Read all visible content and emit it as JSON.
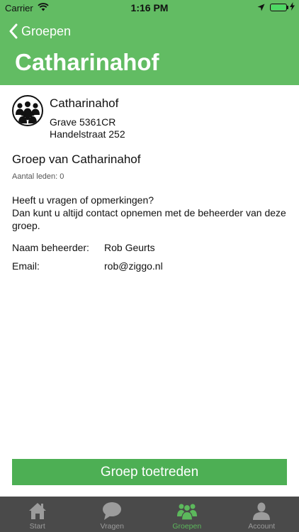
{
  "status_bar": {
    "carrier": "Carrier",
    "time": "1:16 PM"
  },
  "nav": {
    "back_label": "Groepen",
    "title": "Catharinahof"
  },
  "organization": {
    "name": "Catharinahof",
    "city_postcode": "Grave 5361CR",
    "street": "Handelstraat 252",
    "avatar_icon": "group-people-icon"
  },
  "group": {
    "title": "Groep van Catharinahof",
    "member_count": "Aantal leden: 0"
  },
  "contact": {
    "line1": "Heeft u vragen of opmerkingen?",
    "line2": "Dan kunt u altijd contact opnemen met de beheerder van deze groep.",
    "admin_label": "Naam beheerder:",
    "admin_value": "Rob Geurts",
    "email_label": "Email:",
    "email_value": "rob@ziggo.nl"
  },
  "join_button_label": "Groep toetreden",
  "tabs": [
    {
      "label": "Start",
      "icon": "home-icon",
      "active": false
    },
    {
      "label": "Vragen",
      "icon": "chat-bubble-icon",
      "active": false
    },
    {
      "label": "Groepen",
      "icon": "groups-icon",
      "active": true
    },
    {
      "label": "Account",
      "icon": "user-icon",
      "active": false
    }
  ],
  "colors": {
    "header_green": "#62bc63",
    "button_green": "#4daf54",
    "tabbar_bg": "#4a4a4a",
    "tab_inactive": "#9c9c9c",
    "tab_active": "#5cb85c"
  }
}
